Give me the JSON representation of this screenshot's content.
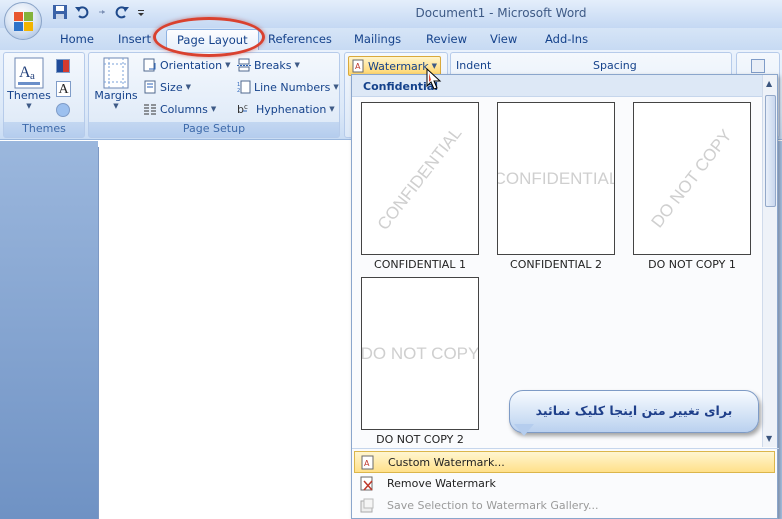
{
  "window": {
    "title": "Document1 - Microsoft Word"
  },
  "tabs": [
    {
      "label": "Home"
    },
    {
      "label": "Insert"
    },
    {
      "label": "Page Layout",
      "active": true
    },
    {
      "label": "References"
    },
    {
      "label": "Mailings"
    },
    {
      "label": "Review"
    },
    {
      "label": "View"
    },
    {
      "label": "Add-Ins"
    }
  ],
  "ribbon": {
    "themes_group": {
      "label": "Themes",
      "button": "Themes"
    },
    "page_setup_group": {
      "label": "Page Setup",
      "margins": "Margins",
      "orientation": "Orientation",
      "size": "Size",
      "columns": "Columns",
      "breaks": "Breaks",
      "line_numbers": "Line Numbers",
      "hyphenation": "Hyphenation"
    },
    "page_background": {
      "watermark": "Watermark"
    },
    "paragraph": {
      "indent": "Indent",
      "spacing": "Spacing"
    }
  },
  "gallery": {
    "header": "Confidential",
    "items": [
      {
        "caption": "CONFIDENTIAL 1",
        "watermark": "CONFIDENTIAL"
      },
      {
        "caption": "CONFIDENTIAL 2",
        "watermark": "CONFIDENTIAL"
      },
      {
        "caption": "DO NOT COPY 1",
        "watermark": "DO NOT COPY"
      },
      {
        "caption": "DO NOT COPY 2",
        "watermark": "DO NOT COPY"
      }
    ],
    "menu": [
      {
        "label": "Custom Watermark..."
      },
      {
        "label": "Remove Watermark"
      },
      {
        "label": "Save Selection to Watermark Gallery..."
      }
    ]
  },
  "callout": {
    "text": "برای تغییر متن اینجا کلیک نمائید"
  },
  "colors": {
    "highlight_ellipse": "#d9412f",
    "hover": "#ffe08a"
  }
}
